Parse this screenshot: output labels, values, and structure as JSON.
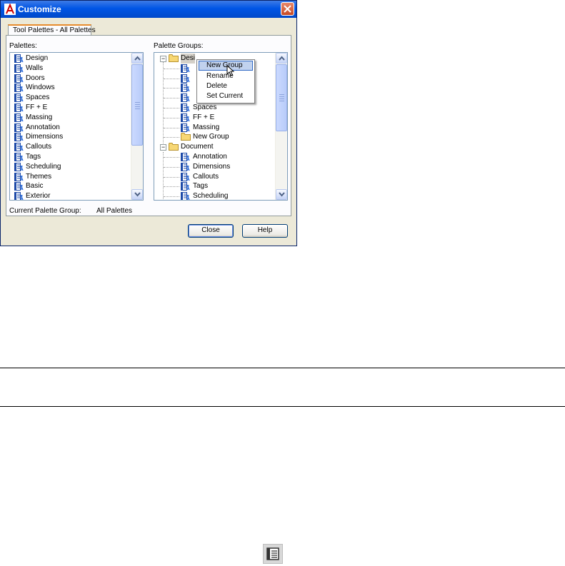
{
  "window": {
    "title": "Customize",
    "app_icon": "autocad-a-icon",
    "close_icon": "close-x-icon"
  },
  "tab": {
    "label": "Tool Palettes - All Palettes"
  },
  "palettes": {
    "label": "Palettes:",
    "items": [
      "Design",
      "Walls",
      "Doors",
      "Windows",
      "Spaces",
      "FF + E",
      "Massing",
      "Annotation",
      "Dimensions",
      "Callouts",
      "Tags",
      "Scheduling",
      "Themes",
      "Basic",
      "Exterior"
    ]
  },
  "palette_groups": {
    "label": "Palette Groups:",
    "tree": [
      {
        "label": "Desi",
        "type": "group",
        "selected": true
      },
      {
        "label": "",
        "type": "palette"
      },
      {
        "label": "",
        "type": "palette"
      },
      {
        "label": "",
        "type": "palette"
      },
      {
        "label": "",
        "type": "palette"
      },
      {
        "label": "Spaces",
        "type": "palette"
      },
      {
        "label": "FF + E",
        "type": "palette"
      },
      {
        "label": "Massing",
        "type": "palette"
      },
      {
        "label": "New Group",
        "type": "folder"
      },
      {
        "label": "Document",
        "type": "group"
      },
      {
        "label": "Annotation",
        "type": "palette"
      },
      {
        "label": "Dimensions",
        "type": "palette"
      },
      {
        "label": "Callouts",
        "type": "palette"
      },
      {
        "label": "Tags",
        "type": "palette"
      },
      {
        "label": "Scheduling",
        "type": "palette"
      }
    ]
  },
  "context_menu": {
    "items": [
      "New Group",
      "Rename",
      "Delete",
      "Set Current"
    ],
    "highlighted": "New Group"
  },
  "current_group": {
    "label": "Current Palette Group:",
    "value": "All Palettes"
  },
  "buttons": {
    "close": "Close",
    "help": "Help"
  },
  "bottom_icon": "palette-properties-icon",
  "colors": {
    "titlebar": "#0055e5",
    "dialog_bg": "#ece9d8",
    "tab_accent": "#e68b2c",
    "menu_highlight": "#c1d2ee"
  }
}
